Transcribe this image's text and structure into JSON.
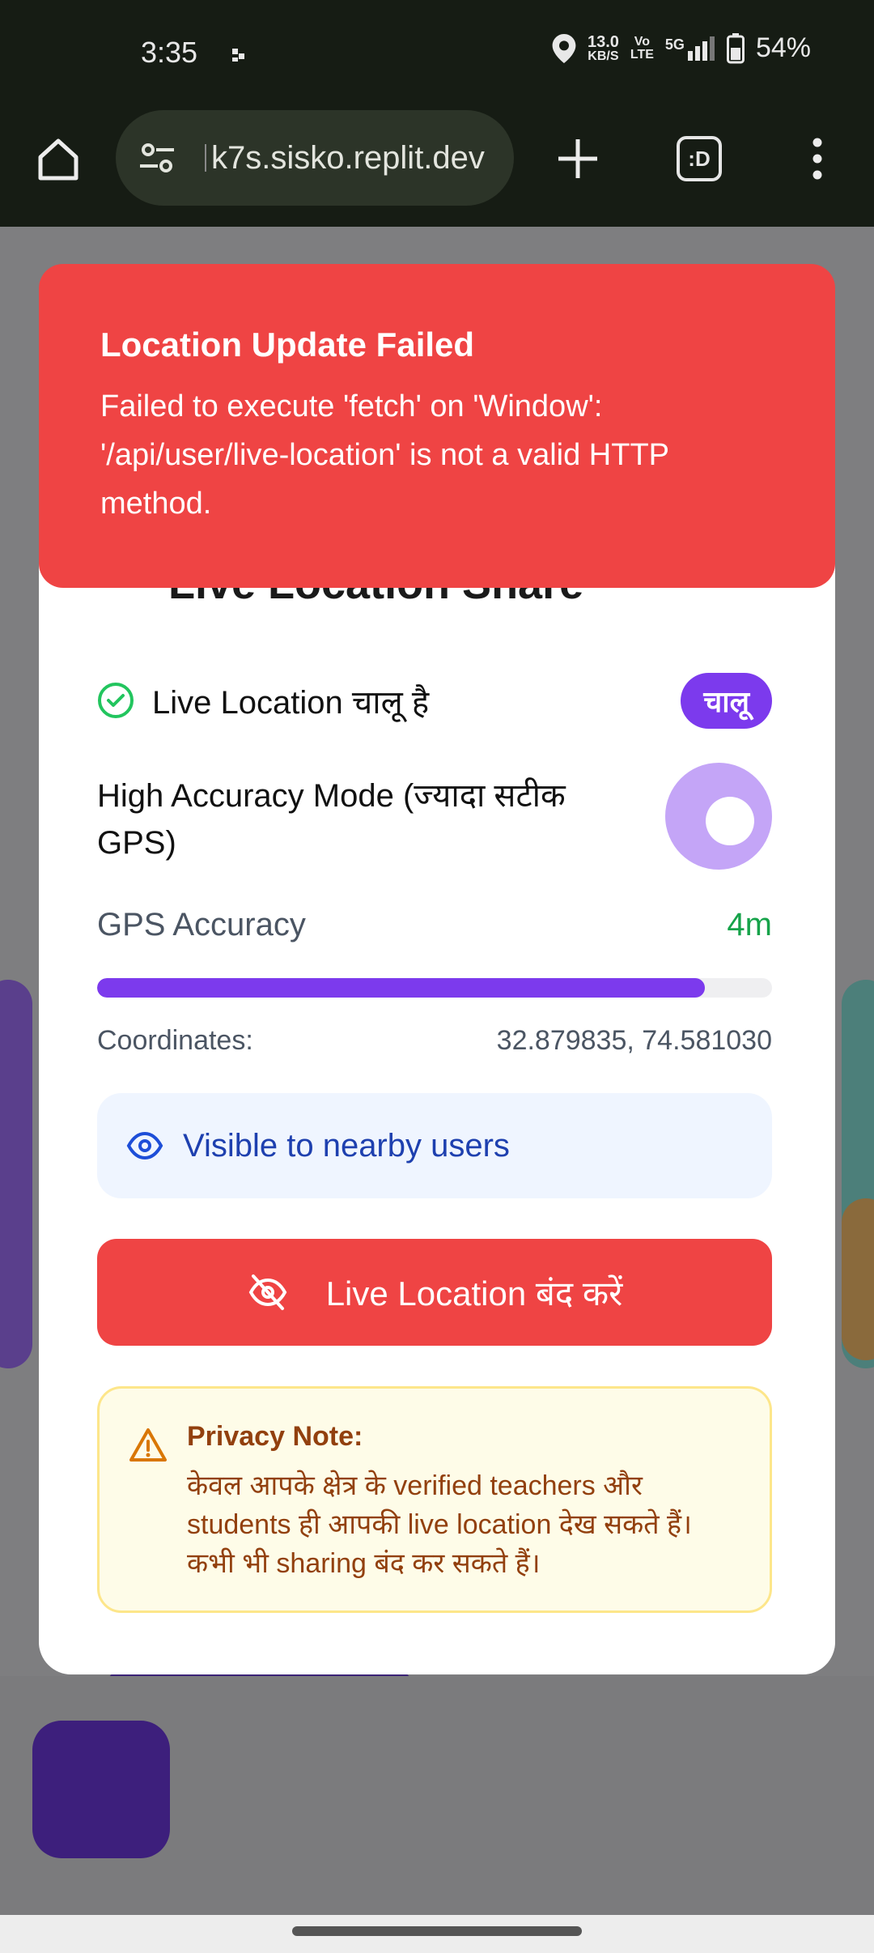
{
  "status_bar": {
    "time": "3:35",
    "net_speed": "13.0",
    "net_unit": "KB/S",
    "volte_top": "Vo",
    "volte_bottom": "LTE",
    "network": "5G",
    "battery": "54%"
  },
  "browser": {
    "url": "k7s.sisko.replit.dev",
    "tabs_label": ":D"
  },
  "toast": {
    "title": "Location Update Failed",
    "message": "Failed to execute 'fetch' on 'Window': '/api/user/live-location' is not a valid HTTP method."
  },
  "card": {
    "title": "Live Location Share",
    "status_text": "Live Location चालू है",
    "status_badge": "चालू",
    "accuracy_mode_label": "High Accuracy Mode (ज्यादा सटीक GPS)",
    "accuracy_mode_on": true,
    "gps_label": "GPS Accuracy",
    "gps_value": "4m",
    "gps_progress_fraction": 0.9,
    "coords_label": "Coordinates:",
    "coords_value": "32.879835, 74.581030",
    "visible_text": "Visible to nearby users",
    "stop_button": "Live Location बंद करें",
    "privacy_title": "Privacy Note:",
    "privacy_body": "केवल आपके क्षेत्र के verified teachers और students ही आपकी live location देख सकते हैं। कभी भी sharing बंद कर सकते हैं।"
  },
  "colors": {
    "accent": "#7c3aed",
    "danger": "#ef4444",
    "success": "#16a34a"
  }
}
